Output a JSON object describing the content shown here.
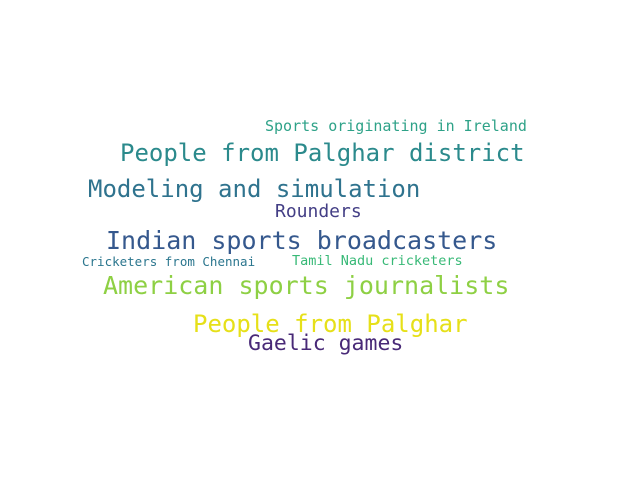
{
  "words": [
    {
      "text": "Sports originating in Ireland",
      "color": "#2ea288"
    },
    {
      "text": "People from Palghar district",
      "color": "#2b8a8c"
    },
    {
      "text": "Modeling and simulation",
      "color": "#2f738e"
    },
    {
      "text": "Rounders",
      "color": "#433e85"
    },
    {
      "text": "Indian sports broadcasters",
      "color": "#35588d"
    },
    {
      "text": "Cricketers from Chennai",
      "color": "#2b768e"
    },
    {
      "text": "Tamil Nadu cricketers",
      "color": "#38b977"
    },
    {
      "text": "American sports journalists",
      "color": "#8ed044"
    },
    {
      "text": "People from Palghar",
      "color": "#e6e019"
    },
    {
      "text": "Gaelic games",
      "color": "#482977"
    }
  ]
}
